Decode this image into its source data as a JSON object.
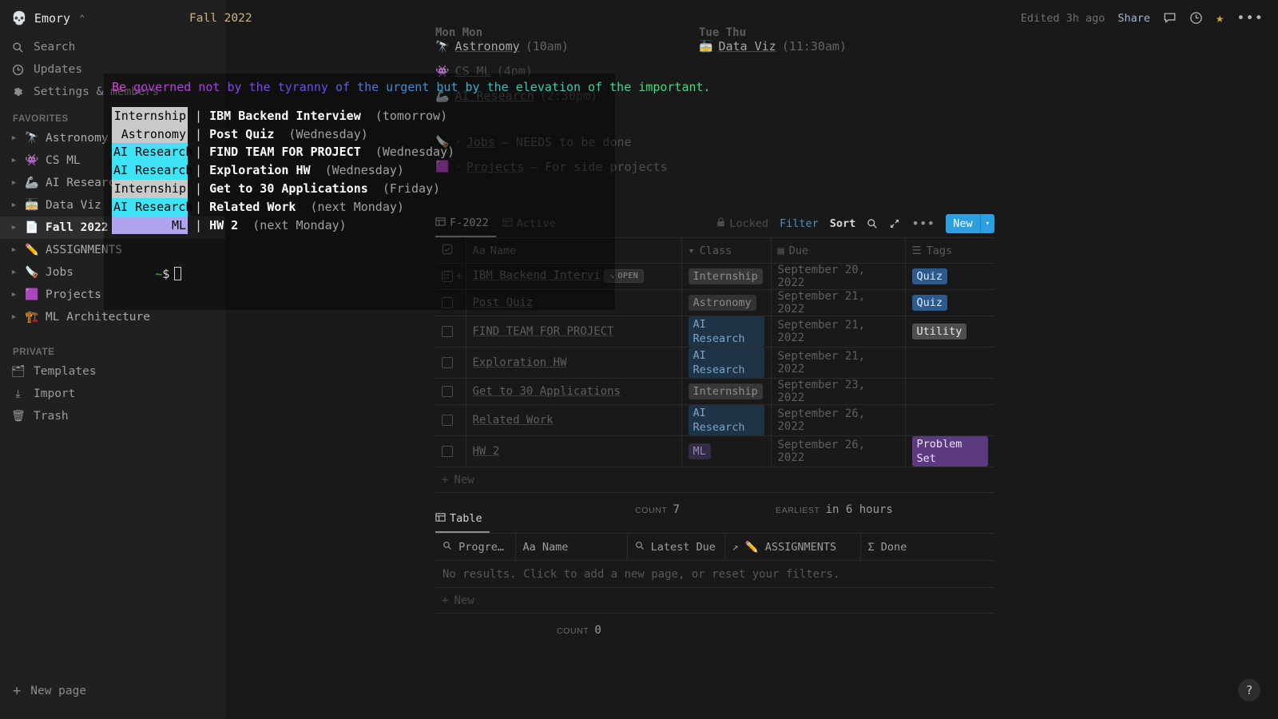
{
  "sidebar": {
    "workspace": {
      "emoji": "💀",
      "name": "Emory",
      "chevron": "⌃⌄"
    },
    "nav": [
      {
        "label": "Search",
        "icon": "search-icon"
      },
      {
        "label": "Updates",
        "icon": "clock-icon"
      },
      {
        "label": "Settings & members",
        "icon": "gear-icon"
      }
    ],
    "favorites_label": "FAVORITES",
    "favorites": [
      {
        "emoji": "🔭",
        "label": "Astronomy",
        "selected": false
      },
      {
        "emoji": "👾",
        "label": "CS ML",
        "selected": false
      },
      {
        "emoji": "🦾",
        "label": "AI Research",
        "selected": false
      },
      {
        "emoji": "🚋",
        "label": "Data Viz",
        "selected": false
      },
      {
        "emoji": "📄",
        "label": "Fall 2022",
        "selected": true
      },
      {
        "emoji": "✏️",
        "label": "ASSIGNMENTS",
        "selected": false
      },
      {
        "emoji": "🪚",
        "label": "Jobs",
        "selected": false
      },
      {
        "emoji": "🟪",
        "label": "Projects",
        "selected": false
      },
      {
        "emoji": "🏗️",
        "label": "ML Architecture",
        "selected": false
      }
    ],
    "private_label": "PRIVATE",
    "private": [
      {
        "emoji": "🗂",
        "label": "Templates"
      },
      {
        "emoji": "⤓",
        "label": "Import"
      },
      {
        "emoji": "🗑",
        "label": "Trash"
      }
    ],
    "new_page": "New page"
  },
  "topbar": {
    "breadcrumb": "Fall 2022",
    "edited": "Edited 3h ago",
    "share": "Share",
    "icons": [
      "comment-icon",
      "history-clock-icon",
      "star-icon",
      "more-menu-icon"
    ]
  },
  "schedule": {
    "columns": [
      {
        "day": "Mon Mon",
        "items": [
          {
            "emoji": "🔭",
            "name": "Astronomy",
            "time": "(10am)",
            "faded": false
          },
          {
            "emoji": "👾",
            "name": "CS ML",
            "time": "(4pm)",
            "faded": true
          },
          {
            "emoji": "🦾",
            "name": "AI Research",
            "time": "(2:30pm)",
            "faded": true
          }
        ]
      },
      {
        "day": "Tue Thu",
        "items": [
          {
            "emoji": "🚋",
            "name": "Data Viz",
            "time": "(11:30am)",
            "faded": false
          }
        ]
      }
    ],
    "links": [
      {
        "emoji": "🪚",
        "name": "Jobs",
        "desc": "— NEEDS to be done"
      },
      {
        "emoji": "🟪",
        "name": "Projects",
        "desc": "— For side projects"
      }
    ]
  },
  "database1": {
    "tabs": [
      {
        "label": "F-2022",
        "active": true
      },
      {
        "label": "Active",
        "active": false
      }
    ],
    "tools": [
      {
        "label": "Locked",
        "style": "lock"
      },
      {
        "label": "Filter",
        "style": "blue"
      },
      {
        "label": "Sort",
        "style": "on"
      },
      {
        "label": "search-icon",
        "style": "icon"
      },
      {
        "label": "expand-icon",
        "style": "icon"
      },
      {
        "label": "more-menu-icon",
        "style": "icon"
      }
    ],
    "new_button": "New",
    "columns": [
      "Name",
      "Class",
      "Due",
      "Tags"
    ],
    "rows": [
      {
        "name": "IBM Backend Intervi",
        "open_badge": "OPEN",
        "class": "Internship",
        "class_style": "p-internship",
        "due": "September 20, 2022",
        "tag": "Quiz",
        "tag_style": "t-quiz"
      },
      {
        "name": "Post Quiz",
        "open_badge": "",
        "class": "Astronomy",
        "class_style": "p-astronomy",
        "due": "September 21, 2022",
        "tag": "Quiz",
        "tag_style": "t-quiz"
      },
      {
        "name": "FIND TEAM FOR PROJECT",
        "open_badge": "",
        "class": "AI Research",
        "class_style": "p-ai",
        "due": "September 21, 2022",
        "tag": "Utility",
        "tag_style": "t-utility"
      },
      {
        "name": "Exploration HW",
        "open_badge": "",
        "class": "AI Research",
        "class_style": "p-ai",
        "due": "September 21, 2022",
        "tag": "",
        "tag_style": ""
      },
      {
        "name": "Get to 30 Applications",
        "open_badge": "",
        "class": "Internship",
        "class_style": "p-internship",
        "due": "September 23, 2022",
        "tag": "",
        "tag_style": ""
      },
      {
        "name": "Related Work",
        "open_badge": "",
        "class": "AI Research",
        "class_style": "p-ai",
        "due": "September 26, 2022",
        "tag": "",
        "tag_style": ""
      },
      {
        "name": "HW 2",
        "open_badge": "",
        "class": "ML",
        "class_style": "p-ml",
        "due": "September 26, 2022",
        "tag": "Problem Set",
        "tag_style": "t-problemset"
      }
    ],
    "new_row": "New",
    "summary": {
      "count_label": "COUNT",
      "count_value": "7",
      "earliest_label": "EARLIEST",
      "earliest_value": "in 6 hours"
    }
  },
  "database2": {
    "tab": "Table",
    "columns": [
      "Progre…",
      "Name",
      "Latest Due",
      "ASSIGNMENTS",
      "Done"
    ],
    "assignments_emoji": "✏️",
    "no_results": "No results. Click to add a new page, or reset your filters.",
    "new_row": "New",
    "summary": {
      "count_label": "COUNT",
      "count_value": "0"
    }
  },
  "terminal": {
    "quote_words": [
      {
        "t": "Be",
        "c": "#e040d8"
      },
      {
        "t": "governed",
        "c": "#c13ce8"
      },
      {
        "t": "not",
        "c": "#ab3bee"
      },
      {
        "t": "by",
        "c": "#8e3ff2"
      },
      {
        "t": "the",
        "c": "#7a45f3"
      },
      {
        "t": "tyranny",
        "c": "#6550f0"
      },
      {
        "t": "of",
        "c": "#5563ea"
      },
      {
        "t": "the",
        "c": "#4a78e4"
      },
      {
        "t": "urgent",
        "c": "#3f8ddc"
      },
      {
        "t": "but",
        "c": "#3aa0d4"
      },
      {
        "t": "by",
        "c": "#35b2cc"
      },
      {
        "t": "the",
        "c": "#32c2c3"
      },
      {
        "t": "elevation",
        "c": "#31cfb6"
      },
      {
        "t": "of",
        "c": "#33d8a4"
      },
      {
        "t": "the",
        "c": "#37dd8f"
      },
      {
        "t": "important.",
        "c": "#3ce07c"
      }
    ],
    "tasks": [
      {
        "class": "Internship",
        "hl": "bg-gray",
        "title": "IBM Backend Interview",
        "when": "(tomorrow)"
      },
      {
        "class": "Astronomy",
        "hl": "bg-gray",
        "title": "Post Quiz",
        "when": "(Wednesday)"
      },
      {
        "class": "AI Research",
        "hl": "bg-cyan",
        "title": "FIND TEAM FOR PROJECT",
        "when": "(Wednesday)"
      },
      {
        "class": "AI Research",
        "hl": "bg-cyan",
        "title": "Exploration HW",
        "when": "(Wednesday)"
      },
      {
        "class": "Internship",
        "hl": "bg-gray",
        "title": "Get to 30 Applications",
        "when": "(Friday)"
      },
      {
        "class": "AI Research",
        "hl": "bg-cyan",
        "title": "Related Work",
        "when": "(next Monday)"
      },
      {
        "class": "ML",
        "hl": "bg-lav",
        "title": "HW 2",
        "when": "(next Monday)"
      }
    ],
    "prompt_tilde": "~",
    "prompt_dollar": "$"
  },
  "help_button": "?"
}
